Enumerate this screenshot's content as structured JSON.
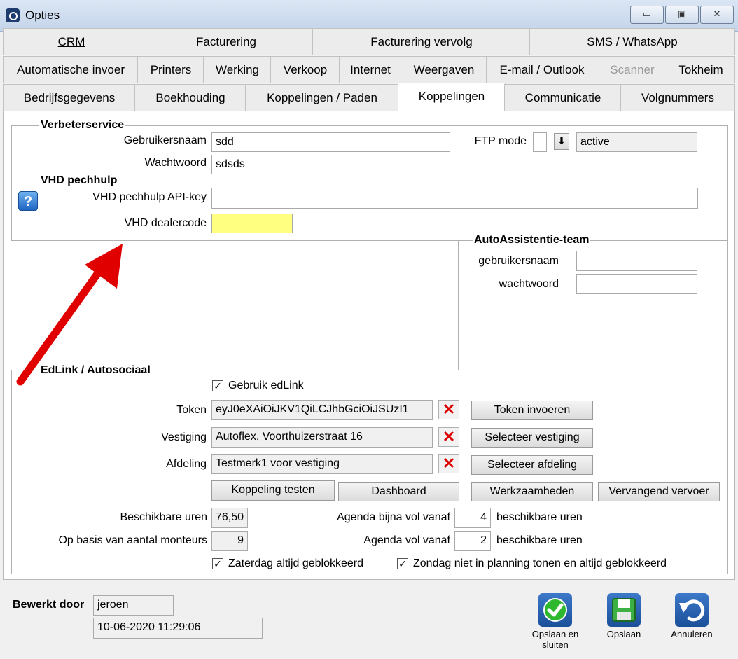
{
  "window": {
    "title": "Opties",
    "minimize_glyph": "▭",
    "restore_glyph": "▣",
    "close_glyph": "✕"
  },
  "tabs": {
    "row1": [
      "CRM",
      "Facturering",
      "Facturering vervolg",
      "SMS / WhatsApp"
    ],
    "row2": [
      "Automatische invoer",
      "Printers",
      "Werking",
      "Verkoop",
      "Internet",
      "Weergaven",
      "E-mail / Outlook",
      "Scanner",
      "Tokheim"
    ],
    "row3": [
      "Bedrijfsgegevens",
      "Boekhouding",
      "Koppelingen / Paden",
      "Koppelingen",
      "Communicatie",
      "Volgnummers"
    ]
  },
  "verbeterservice": {
    "title": "Verbeterservice",
    "username_label": "Gebruikersnaam",
    "username_value": "sdd",
    "password_label": "Wachtwoord",
    "password_value": "sdsds",
    "ftp_label": "FTP mode",
    "ftp_value": "active"
  },
  "vhd": {
    "title": "VHD pechhulp",
    "help_glyph": "?",
    "apikey_label": "VHD pechhulp API-key",
    "apikey_value": "",
    "dealercode_label": "VHD dealercode",
    "dealercode_value": ""
  },
  "autoassistentie": {
    "title": "AutoAssistentie-team",
    "username_label": "gebruikersnaam",
    "password_label": "wachtwoord"
  },
  "edlink": {
    "title": "EdLink / Autosociaal",
    "use_label": "Gebruik edLink",
    "use_checked": true,
    "token_label": "Token",
    "token_value": "eyJ0eXAiOiJKV1QiLCJhbGciOiJSUzI1",
    "token_button": "Token invoeren",
    "vestiging_label": "Vestiging",
    "vestiging_value": "Autoflex, Voorthuizerstraat 16",
    "vestiging_button": "Selecteer vestiging",
    "afdeling_label": "Afdeling",
    "afdeling_value": "Testmerk1 voor vestiging",
    "afdeling_button": "Selecteer afdeling",
    "clear_glyph": "✕",
    "buttons": [
      "Koppeling testen",
      "Dashboard",
      "Werkzaamheden",
      "Vervangend vervoer"
    ],
    "hours_label": "Beschikbare uren",
    "hours_value": "76,50",
    "mechanics_label": "Op basis van aantal monteurs",
    "mechanics_value": "9",
    "almost_full_label": "Agenda bijna vol vanaf",
    "almost_full_value": "4",
    "full_label": "Agenda vol vanaf",
    "full_value": "2",
    "hours_unit": "beschikbare uren",
    "saturday_label": "Zaterdag altijd geblokkeerd",
    "sunday_label": "Zondag niet in planning tonen en altijd geblokkeerd"
  },
  "footer": {
    "edited_by_label": "Bewerkt door",
    "edited_by_value": "jeroen",
    "edited_date": "10-06-2020 11:29:06",
    "save_close_label": "Opslaan en sluiten",
    "save_label": "Opslaan",
    "cancel_label": "Annuleren"
  }
}
